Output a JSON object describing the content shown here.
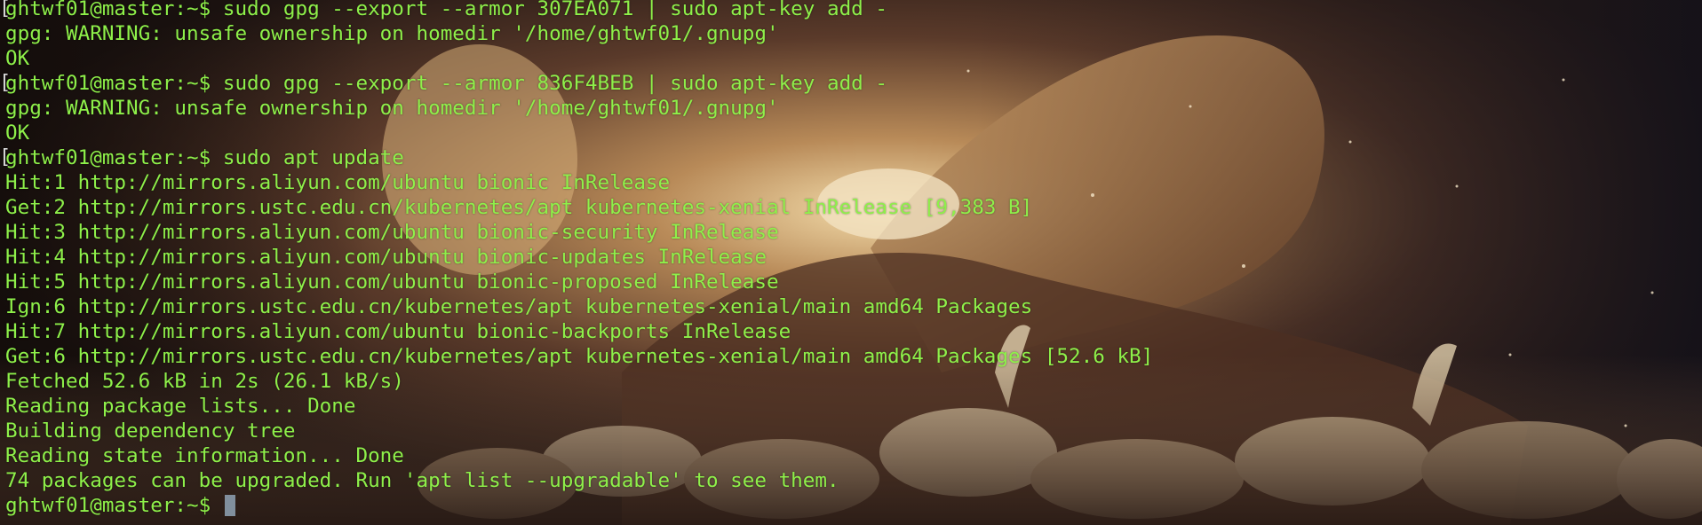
{
  "terminal": {
    "lines": [
      {
        "text": "ghtwf01@master:~$ sudo gpg --export --armor 307EA071 | sudo apt-key add -",
        "marker": true
      },
      {
        "text": "gpg: WARNING: unsafe ownership on homedir '/home/ghtwf01/.gnupg'",
        "marker": false
      },
      {
        "text": "OK",
        "marker": false
      },
      {
        "text": "ghtwf01@master:~$ sudo gpg --export --armor 836F4BEB | sudo apt-key add -",
        "marker": true
      },
      {
        "text": "gpg: WARNING: unsafe ownership on homedir '/home/ghtwf01/.gnupg'",
        "marker": false
      },
      {
        "text": "OK",
        "marker": false
      },
      {
        "text": "ghtwf01@master:~$ sudo apt update",
        "marker": true
      },
      {
        "text": "Hit:1 http://mirrors.aliyun.com/ubuntu bionic InRelease",
        "marker": false
      },
      {
        "text": "Get:2 http://mirrors.ustc.edu.cn/kubernetes/apt kubernetes-xenial InRelease [9,383 B]",
        "marker": false
      },
      {
        "text": "Hit:3 http://mirrors.aliyun.com/ubuntu bionic-security InRelease",
        "marker": false
      },
      {
        "text": "Hit:4 http://mirrors.aliyun.com/ubuntu bionic-updates InRelease",
        "marker": false
      },
      {
        "text": "Hit:5 http://mirrors.aliyun.com/ubuntu bionic-proposed InRelease",
        "marker": false
      },
      {
        "text": "Ign:6 http://mirrors.ustc.edu.cn/kubernetes/apt kubernetes-xenial/main amd64 Packages",
        "marker": false
      },
      {
        "text": "Hit:7 http://mirrors.aliyun.com/ubuntu bionic-backports InRelease",
        "marker": false
      },
      {
        "text": "Get:6 http://mirrors.ustc.edu.cn/kubernetes/apt kubernetes-xenial/main amd64 Packages [52.6 kB]",
        "marker": false
      },
      {
        "text": "Fetched 52.6 kB in 2s (26.1 kB/s)",
        "marker": false
      },
      {
        "text": "Reading package lists... Done",
        "marker": false
      },
      {
        "text": "Building dependency tree",
        "marker": false
      },
      {
        "text": "Reading state information... Done",
        "marker": false
      },
      {
        "text": "74 packages can be upgraded. Run 'apt list --upgradable' to see them.",
        "marker": false
      }
    ],
    "prompt": "ghtwf01@master:~$ ",
    "marker_glyph": "[",
    "text_color": "#8ef04a",
    "cursor_color": "#8fa3b5"
  }
}
